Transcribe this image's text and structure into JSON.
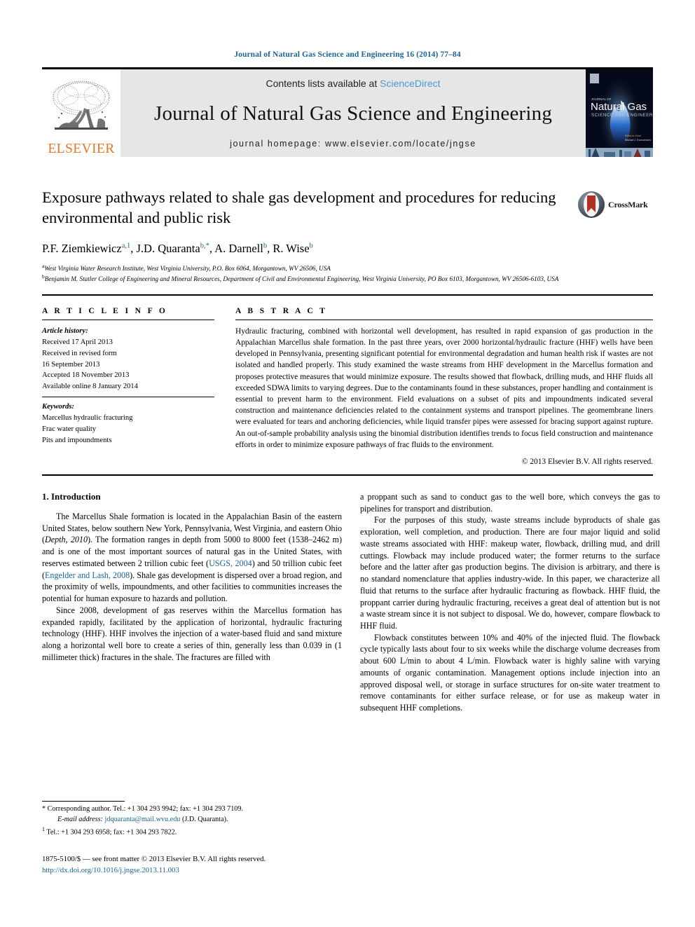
{
  "running_head": "Journal of Natural Gas Science and Engineering 16 (2014) 77–84",
  "banner": {
    "publisher_name": "ELSEVIER",
    "contents_prefix": "Contents lists available at ",
    "contents_link": "ScienceDirect",
    "journal_name": "Journal of Natural Gas Science and Engineering",
    "homepage": "journal homepage: www.elsevier.com/locate/jngse",
    "cover_title_small": "JOURNAL OF",
    "cover_title": "Natural Gas",
    "cover_subtitle": "SCIENCE AND ENGINEERING"
  },
  "article": {
    "title": "Exposure pathways related to shale gas development and procedures for reducing environmental and public risk",
    "crossmark_label": "CrossMark",
    "authors": [
      {
        "name": "P.F. Ziemkiewicz",
        "marks": "a,1"
      },
      {
        "name": "J.D. Quaranta",
        "marks": "b,*"
      },
      {
        "name": "A. Darnell",
        "marks": "b"
      },
      {
        "name": "R. Wise",
        "marks": "b"
      }
    ],
    "affiliations": [
      {
        "mark": "a",
        "text": "West Virginia Water Research Institute, West Virginia University, P.O. Box 6064, Morgantown, WV 26506, USA"
      },
      {
        "mark": "b",
        "text": "Benjamin M. Statler College of Engineering and Mineral Resources, Department of Civil and Environmental Engineering, West Virginia University, PO Box 6103, Morgantown, WV 26506-6103, USA"
      }
    ]
  },
  "article_info": {
    "heading": "A R T I C L E   I N F O",
    "history_label": "Article history:",
    "history": [
      "Received 17 April 2013",
      "Received in revised form",
      "16 September 2013",
      "Accepted 18 November 2013",
      "Available online 8 January 2014"
    ],
    "keywords_label": "Keywords:",
    "keywords": [
      "Marcellus hydraulic fracturing",
      "Frac water quality",
      "Pits and impoundments"
    ]
  },
  "abstract": {
    "heading": "A B S T R A C T",
    "text": "Hydraulic fracturing, combined with horizontal well development, has resulted in rapid expansion of gas production in the Appalachian Marcellus shale formation. In the past three years, over 2000 horizontal/hydraulic fracture (HHF) wells have been developed in Pennsylvania, presenting significant potential for environmental degradation and human health risk if wastes are not isolated and handled properly. This study examined the waste streams from HHF development in the Marcellus formation and proposes protective measures that would minimize exposure. The results showed that flowback, drilling muds, and HHF fluids all exceeded SDWA limits to varying degrees. Due to the contaminants found in these substances, proper handling and containment is essential to prevent harm to the environment. Field evaluations on a subset of pits and impoundments indicated several construction and maintenance deficiencies related to the containment systems and transport pipelines. The geomembrane liners were evaluated for tears and anchoring deficiencies, while liquid transfer pipes were assessed for bracing support against rupture. An out-of-sample probability analysis using the binomial distribution identifies trends to focus field construction and maintenance efforts in order to minimize exposure pathways of frac fluids to the environment.",
    "copyright": "© 2013 Elsevier B.V. All rights reserved."
  },
  "body": {
    "section_title": "1. Introduction",
    "left_paragraphs": [
      "The Marcellus Shale formation is located in the Appalachian Basin of the eastern United States, below southern New York, Pennsylvania, West Virginia, and eastern Ohio (Depth, 2010). The formation ranges in depth from 5000 to 8000 feet (1538–2462 m) and is one of the most important sources of natural gas in the United States, with reserves estimated between 2 trillion cubic feet (USGS, 2004) and 50 trillion cubic feet (Engelder and Lash, 2008). Shale gas development is dispersed over a broad region, and the proximity of wells, impoundments, and other facilities to communities increases the potential for human exposure to hazards and pollution.",
      "Since 2008, development of gas reserves within the Marcellus formation has expanded rapidly, facilitated by the application of horizontal, hydraulic fracturing technology (HHF). HHF involves the injection of a water-based fluid and sand mixture along a horizontal well bore to create a series of thin, generally less than 0.039 in (1 millimeter thick) fractures in the shale. The fractures are filled with"
    ],
    "right_paragraphs": [
      "a proppant such as sand to conduct gas to the well bore, which conveys the gas to pipelines for transport and distribution.",
      "For the purposes of this study, waste streams include byproducts of shale gas exploration, well completion, and production. There are four major liquid and solid waste streams associated with HHF: makeup water, flowback, drilling mud, and drill cuttings. Flowback may include produced water; the former returns to the surface before and the latter after gas production begins. The division is arbitrary, and there is no standard nomenclature that applies industry-wide. In this paper, we characterize all fluid that returns to the surface after hydraulic fracturing as flowback. HHF fluid, the proppant carrier during hydraulic fracturing, receives a great deal of attention but is not a waste stream since it is not subject to disposal. We do, however, compare flowback to HHF fluid.",
      "Flowback constitutes between 10% and 40% of the injected fluid. The flowback cycle typically lasts about four to six weeks while the discharge volume decreases from about 600 L/min to about 4 L/min. Flowback water is highly saline with varying amounts of organic contamination. Management options include injection into an approved disposal well, or storage in surface structures for on-site water treatment to remove contaminants for either surface release, or for use as makeup water in subsequent HHF completions."
    ],
    "citation_links": [
      "USGS, 2004",
      "Engelder and Lash, 2008"
    ],
    "italic_terms": [
      "Depth, 2010"
    ]
  },
  "footnotes": {
    "corresponding": "* Corresponding author. Tel.: +1 304 293 9942; fax: +1 304 293 7109.",
    "email_label": "E-mail address:",
    "email": "jdquaranta@mail.wvu.edu",
    "email_owner": "(J.D. Quaranta).",
    "note1_mark": "1",
    "note1": "Tel.: +1 304 293 6958; fax: +1 304 293 7822."
  },
  "imprint": {
    "issn_line": "1875-5100/$ — see front matter © 2013 Elsevier B.V. All rights reserved.",
    "doi": "http://dx.doi.org/10.1016/j.jngse.2013.11.003"
  },
  "colors": {
    "link_blue": "#1a6496",
    "sciencedirect_blue": "#4a9ad4",
    "elsevier_orange": "#E87722",
    "crossmark_red": "#b23122",
    "banner_gray": "#e6e6e6"
  }
}
